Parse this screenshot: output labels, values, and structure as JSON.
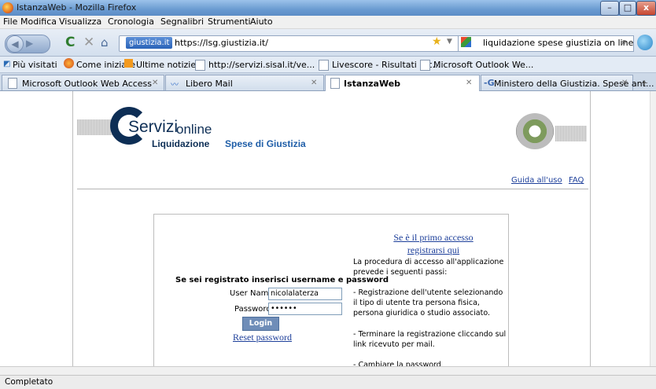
{
  "window": {
    "title": "IstanzaWeb - Mozilla Firefox",
    "minimize": "–",
    "maximize": "□",
    "close": "x"
  },
  "menu": [
    "File",
    "Modifica",
    "Visualizza",
    "Cronologia",
    "Segnalibri",
    "Strumenti",
    "Aiuto"
  ],
  "nav": {
    "site_badge": "giustizia.it",
    "url": "https://lsg.giustizia.it/",
    "search_value": "liquidazione spese giustizia on line",
    "icons": [
      "back-icon",
      "forward-icon",
      "reload-icon",
      "stop-icon",
      "home-icon",
      "star-icon",
      "search-icon"
    ]
  },
  "bookmarks": [
    "Più visitati",
    "Come iniziare",
    "Ultime notizie",
    "http://servizi.sisal.it/ve...",
    "Livescore - Risultati e c...",
    "Microsoft Outlook We..."
  ],
  "tabs": [
    {
      "label": "Microsoft Outlook Web Access",
      "active": false
    },
    {
      "label": "Libero Mail",
      "active": false
    },
    {
      "label": "IstanzaWeb",
      "active": true
    },
    {
      "label": "Ministero della Giustizia. Spese ant...",
      "active": false
    }
  ],
  "page": {
    "logo": {
      "servizi": "Servizi",
      "online": "online",
      "sub1": "Liquidazione",
      "sub2": "Spese di Giustizia"
    },
    "links": {
      "guide": "Guida all'uso",
      "faq": "FAQ"
    },
    "first_access": "Se è il primo accesso registrarsi qui",
    "info": [
      "La procedura di accesso all'applicazione prevede i seguenti passi:",
      "- Registrazione dell'utente selezionando il tipo di utente tra persona fisica, persona giuridica o studio associato.",
      "- Terminare la registrazione cliccando sul link ricevuto per mail.",
      "- Cambiare la password"
    ],
    "login": {
      "heading": "Se sei registrato inserisci username e password",
      "user_label": "User Name:",
      "user_value": "nicolalaterza",
      "pass_label": "Password:",
      "pass_value": "••••••",
      "button": "Login",
      "reset": "Reset password"
    }
  },
  "status": "Completato",
  "colors": {
    "brand": "#0d2e55",
    "link": "#1d3f9a",
    "accent": "#1f5ea8"
  }
}
